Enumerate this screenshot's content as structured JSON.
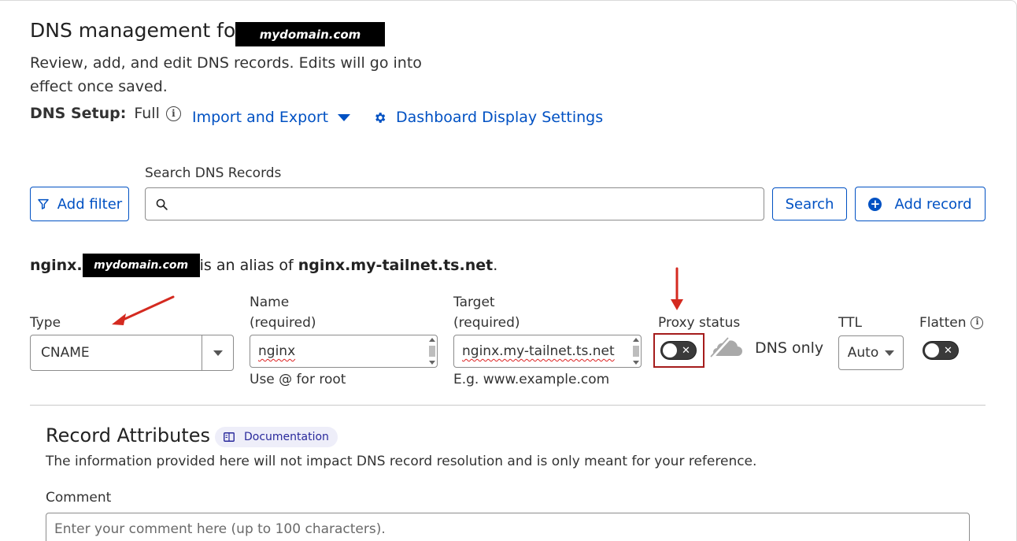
{
  "header": {
    "title": "DNS management for",
    "domain_redacted": "mydomain.com",
    "subtitle": "Review, add, and edit DNS records. Edits will go into effect once saved."
  },
  "setup": {
    "label": "DNS Setup:",
    "value": "Full",
    "info_icon": "info-icon",
    "import_export": "Import and Export",
    "dashboard_settings": "Dashboard Display Settings"
  },
  "toolbar": {
    "add_filter": "Add filter",
    "search_label": "Search DNS Records",
    "search_placeholder": "",
    "search_button": "Search",
    "add_record": "Add record"
  },
  "alias": {
    "host": "nginx.",
    "domain_redacted": "mydomain.com",
    "middle": "is an alias of",
    "target": "nginx.my-tailnet.ts.net",
    "end": "."
  },
  "record_form": {
    "type_label": "Type",
    "type_value": "CNAME",
    "name_label_1": "Name",
    "name_label_2": "(required)",
    "name_value": "nginx",
    "name_hint": "Use @ for root",
    "target_label_1": "Target",
    "target_label_2": "(required)",
    "target_value": "nginx.my-tailnet.ts.net",
    "target_hint": "E.g. www.example.com",
    "proxy_label": "Proxy status",
    "proxy_enabled": false,
    "proxy_state_text": "DNS only",
    "ttl_label": "TTL",
    "ttl_value": "Auto",
    "flatten_label": "Flatten",
    "flatten_enabled": false
  },
  "record_attributes": {
    "title": "Record Attributes",
    "doc_button": "Documentation",
    "description": "The information provided here will not impact DNS record resolution and is only meant for your reference.",
    "comment_label": "Comment",
    "comment_placeholder": "Enter your comment here (up to 100 characters)."
  },
  "colors": {
    "link_blue": "#0051c3",
    "annotation_red": "#d42a20",
    "highlight_border": "#a51c1c"
  }
}
